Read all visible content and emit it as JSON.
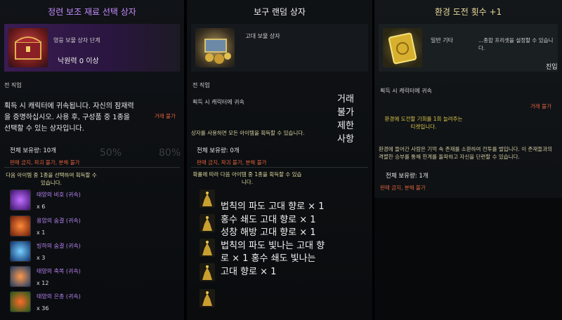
{
  "panel1": {
    "title": "정련 보조 재료 선택 상자",
    "subtitle": "영웅 보물 상자 단계",
    "requirement": "낙원력 0 이상",
    "class_label": "전 직업",
    "description": "획득 시 캐릭터에 귀속됩니다. 자신의 잠재력을 증명하십시오. 사용 후, 구성품 중 1종을 선택할 수 있는 상자입니다.",
    "trade_text": "거래 불가",
    "holdings": "전체 보유량: 10개",
    "restrictions": "판매 금지, 파괴 불가, 분해 불가",
    "select_note": "다음 아이템 중 1종을 선택하여 획득할 수 있습니다.",
    "ghost_text": [
      "50%",
      "80%"
    ],
    "items": [
      {
        "name": "태양의 비호 (귀속)",
        "qty": "x 6",
        "color": "#8a2fd0"
      },
      {
        "name": "용암의 숨결 (귀속)",
        "qty": "x 1",
        "color": "#c2381a"
      },
      {
        "name": "빙하의 숨결 (귀속)",
        "qty": "x 3",
        "color": "#2a7fd8"
      },
      {
        "name": "태양의 축복 (귀속)",
        "qty": "x 12",
        "color": "#2e7fc0"
      },
      {
        "name": "태양의 은총 (귀속)",
        "qty": "x 36",
        "color": "#2e9a30"
      }
    ]
  },
  "panel2": {
    "title": "보구 랜덤 상자",
    "item_name": "고대 보물 상자",
    "class_label": "전 직업",
    "bind_text": "획득 시 캐릭터에 귀속",
    "trade_vertical": "거래 불가 제한 사항",
    "use_note": "상자를 사용하면 모든 아이템을 획득할 수 있습니다.",
    "holdings": "전체 보유량: 0개",
    "restrictions": "판매 금지, 파괴 불가, 분해 불가",
    "probability_note": "확률에 따라 다음 아이템 중 1종을 획득할 수 있습니다.",
    "contents_text": "법칙의 파도 고대 향로 × 1 홍수 쇄도 고대 향로 × 1 성창 해방 고대 향로 × 1 법칙의 파도 빛나는 고대 향로 × 1 홍수 쇄도 빛나는 고대 향로 × 1"
  },
  "panel3": {
    "title": "환경 도전 횟수 +1",
    "grade": "일반 기타",
    "preset_note": "...종합 프리셋을 설정할 수 있습니다.",
    "enter_text": "진입",
    "bind_text": "획득 시 캐릭터에 귀속",
    "trade_text": "거래 불가",
    "effect": "환경에 도전할 기회를 1회 늘려주는 티켓입니다.",
    "lore": "환경에 들어간 사람은 기억 속 존재를 소환하여 전투를 벌입니다. 이 존재들과의 격렬한 승부를 통해 한계를 돌파하고 자신을 단련할 수 있습니다.",
    "holdings": "전체 보유량: 1개",
    "restrictions": "판매 금지, 분해 불가"
  }
}
